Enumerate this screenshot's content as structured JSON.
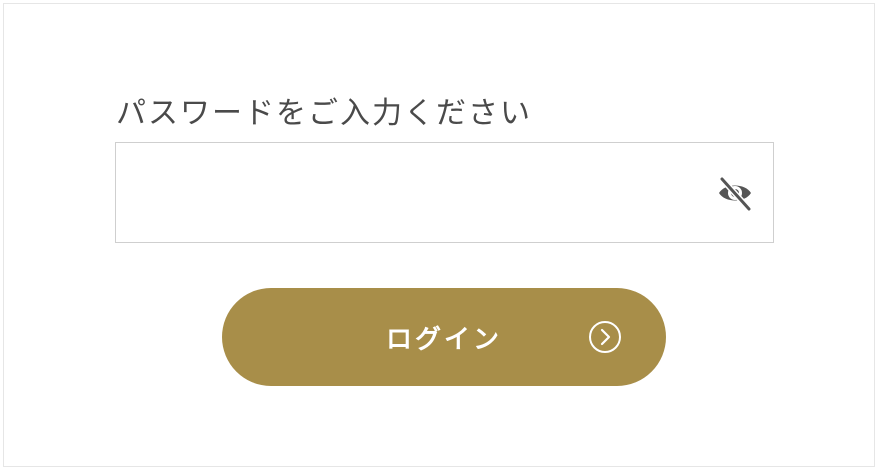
{
  "form": {
    "password_label": "パスワードをご入力ください",
    "password_value": "",
    "password_placeholder": "",
    "toggle_icon": "eye-off-icon",
    "login_label": "ログイン",
    "login_icon": "circle-chevron-right-icon"
  },
  "colors": {
    "accent": "#a88e49",
    "label_text": "#4a4a4a",
    "input_border": "#cfcfcf",
    "icon": "#555555"
  }
}
